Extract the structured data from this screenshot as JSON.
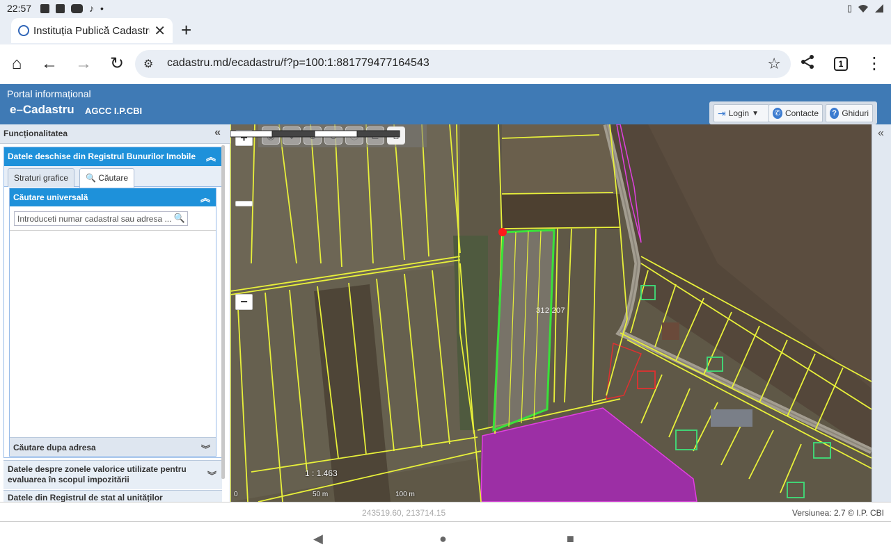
{
  "status_bar": {
    "time": "22:57",
    "dot": "•"
  },
  "browser": {
    "tab_title": "Instituția Publică Cadastrul",
    "close": "✕",
    "new_tab": "+",
    "url": "cadastru.md/ecadastru/f?p=100:1:881779477164543",
    "tab_count": "1"
  },
  "header": {
    "portal": "Portal informațional",
    "brand": "e–Cadastru",
    "agency": "AGCC I.P.CBI",
    "tools": {
      "login": "Login",
      "contacts": "Contacte",
      "guides": "Ghiduri"
    }
  },
  "sidebar": {
    "title": "Funcționalitatea",
    "collapse": "«",
    "panel_title": "Datele deschise din Registrul Bunurilor Imobile",
    "tabs": [
      {
        "label": "Straturi grafice"
      },
      {
        "label": "Căutare"
      }
    ],
    "search_panel_title": "Căutare universală",
    "search_placeholder": "Introduceti numar cadastral sau adresa ...",
    "address_search": "Căutare dupa adresa",
    "accordion": [
      {
        "label": "Datele despre zonele valorice utilizate pentru evaluarea în scopul impozitării"
      },
      {
        "label": "Datele din Registrul de stat al unităților"
      }
    ]
  },
  "map": {
    "zoom_in": "+",
    "zoom_out": "−",
    "parcel_label": "312 207",
    "scale": "1 : 1.463",
    "scale_ticks": [
      "0",
      "50 m",
      "100 m"
    ]
  },
  "right_panel": {
    "collapse": "«"
  },
  "footer": {
    "coordinates": "243519.60, 213714.15",
    "version": "Versiunea: 2.7 © I.P. CBI"
  },
  "icons": [
    "image-icon",
    "stop-icon",
    "youtube-icon",
    "tiktok-icon",
    "vibrate-icon",
    "wifi-icon",
    "signal-icon",
    "home-icon",
    "back-arrow-icon",
    "forward-arrow-icon",
    "reload-icon",
    "tune-icon",
    "star-icon",
    "share-icon",
    "menu-dots-icon",
    "login-icon",
    "phone-icon",
    "help-icon",
    "search-icon"
  ]
}
